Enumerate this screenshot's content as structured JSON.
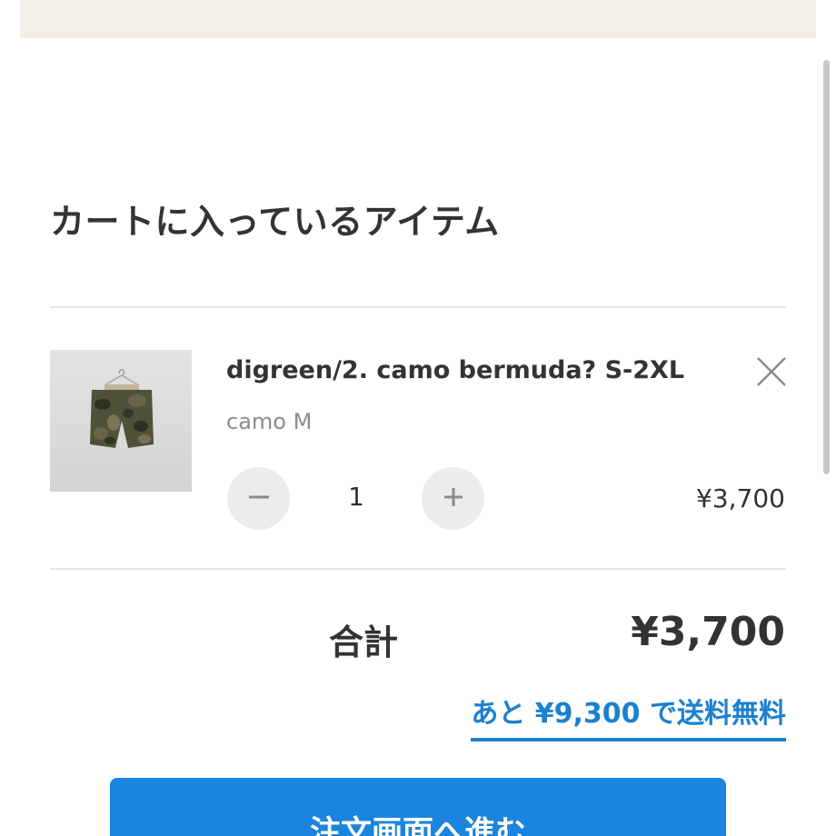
{
  "cart": {
    "title": "カートに入っているアイテム"
  },
  "item": {
    "name": "digreen/2. camo bermuda? S-2XL",
    "variant": "camo M",
    "quantity": "1",
    "price": "¥3,700",
    "remove_icon": "close-icon",
    "decrement_icon": "minus-icon",
    "increment_icon": "plus-icon",
    "image": "camo-shorts-photo"
  },
  "summary": {
    "total_label": "合計",
    "total_value": "¥3,700",
    "free_shipping_text": "あと ¥9,300 で送料無料"
  },
  "checkout": {
    "label": "注文画面へ進む"
  },
  "colors": {
    "accent": "#1a84de",
    "link": "#1a80d0",
    "banner": "#f4efe6",
    "text": "#333333",
    "muted": "#8c8c8c"
  }
}
